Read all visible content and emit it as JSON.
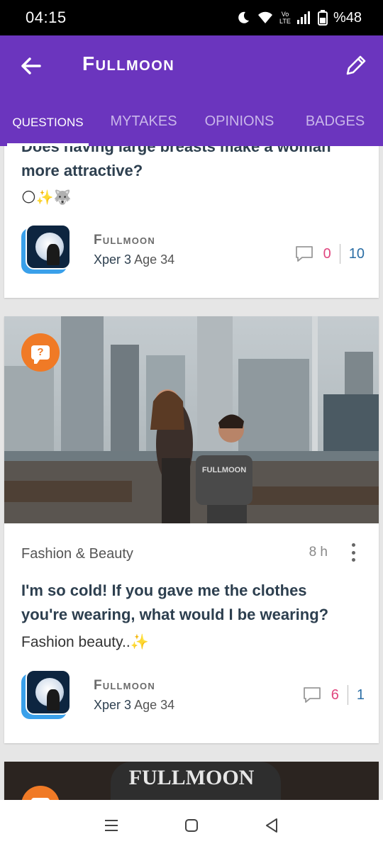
{
  "status_bar": {
    "time": "04:15",
    "battery": "%48",
    "network": "Vo LTE"
  },
  "app_bar": {
    "title": "Fullmoon"
  },
  "tabs": [
    {
      "label": "QUESTIONS",
      "active": true
    },
    {
      "label": "MYTAKES",
      "active": false
    },
    {
      "label": "OPINIONS",
      "active": false
    },
    {
      "label": "BADGES",
      "active": false
    }
  ],
  "cards": [
    {
      "title_partial": "Does having large breasts make a woman",
      "title_end": "more attractive?",
      "description": "🌕✨🐺",
      "author": {
        "name": "Fullmoon",
        "level": "Xper 3",
        "age": "Age 34"
      },
      "stats": {
        "comments": "0",
        "opinions": "10"
      }
    },
    {
      "category": "Fashion & Beauty",
      "time_ago": "8 h",
      "title_line1": "I'm so cold! If you gave me the clothes",
      "title_line2": "you're wearing, what would I be wearing?",
      "description": "Fashion beauty..✨",
      "shirt_text": "FULLMOON",
      "author": {
        "name": "Fullmoon",
        "level": "Xper 3",
        "age": "Age 34"
      },
      "stats": {
        "comments": "6",
        "opinions": "1"
      }
    },
    {
      "shirt_text": "FULLMOON"
    }
  ],
  "colors": {
    "primary": "#6b35be",
    "accent_orange": "#f07a26",
    "comment_pink": "#e0467f",
    "opinion_blue": "#2b6ea5"
  }
}
